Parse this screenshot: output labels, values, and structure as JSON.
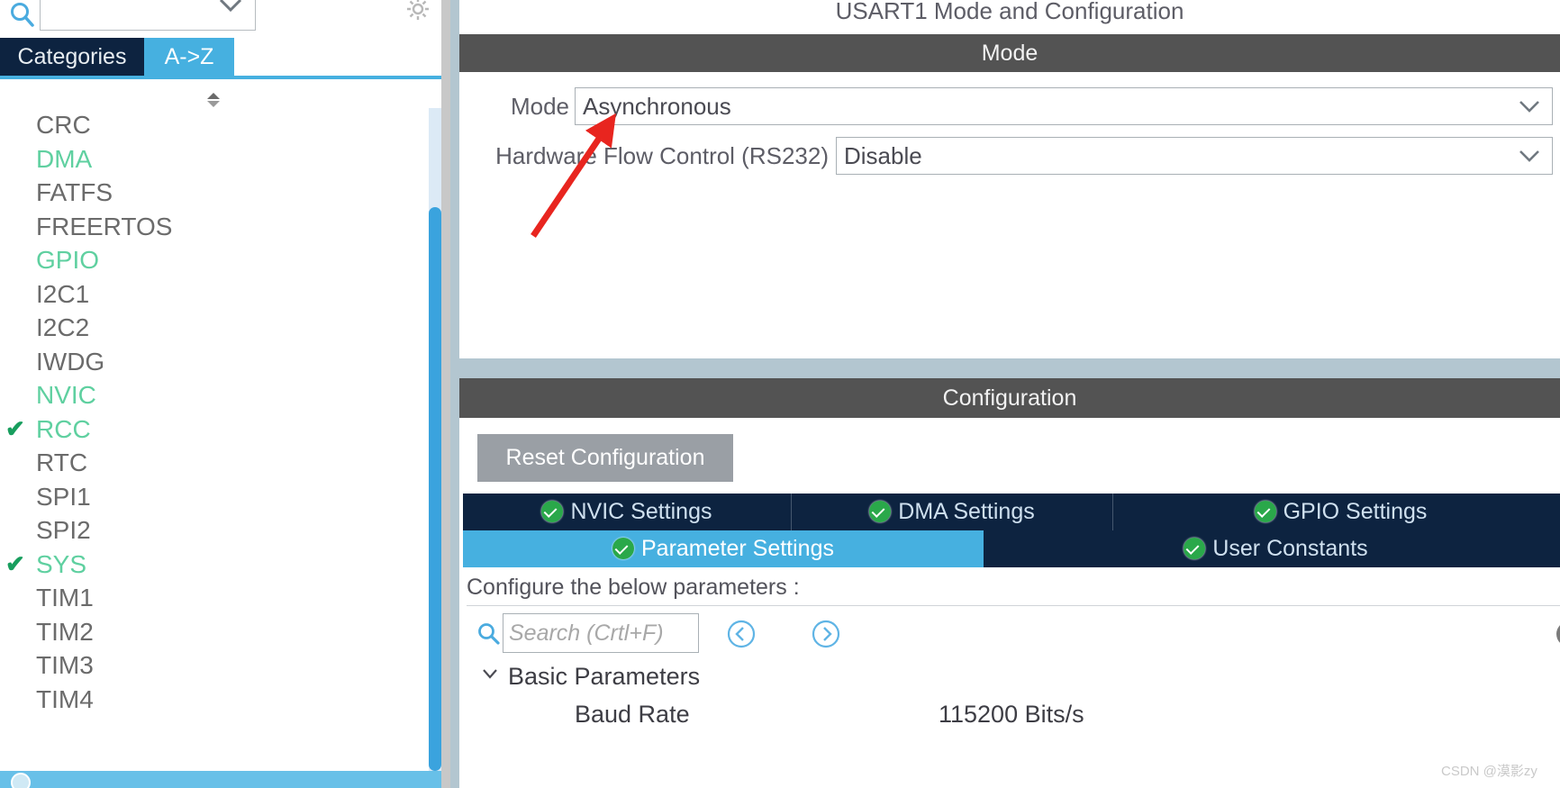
{
  "left_panel": {
    "search": {
      "value": "",
      "placeholder": ""
    },
    "gear_icon": "gear-icon",
    "search_icon": "search-icon",
    "tabs": [
      {
        "label": "Categories",
        "active": false
      },
      {
        "label": "A->Z",
        "active": true
      }
    ],
    "ip_items": [
      {
        "label": "CRC",
        "enabled": false,
        "checked": false
      },
      {
        "label": "DMA",
        "enabled": true,
        "checked": false
      },
      {
        "label": "FATFS",
        "enabled": false,
        "checked": false
      },
      {
        "label": "FREERTOS",
        "enabled": false,
        "checked": false
      },
      {
        "label": "GPIO",
        "enabled": true,
        "checked": false
      },
      {
        "label": "I2C1",
        "enabled": false,
        "checked": false
      },
      {
        "label": "I2C2",
        "enabled": false,
        "checked": false
      },
      {
        "label": "IWDG",
        "enabled": false,
        "checked": false
      },
      {
        "label": "NVIC",
        "enabled": true,
        "checked": false
      },
      {
        "label": "RCC",
        "enabled": true,
        "checked": true
      },
      {
        "label": "RTC",
        "enabled": false,
        "checked": false
      },
      {
        "label": "SPI1",
        "enabled": false,
        "checked": false
      },
      {
        "label": "SPI2",
        "enabled": false,
        "checked": false
      },
      {
        "label": "SYS",
        "enabled": true,
        "checked": true
      },
      {
        "label": "TIM1",
        "enabled": false,
        "checked": false
      },
      {
        "label": "TIM2",
        "enabled": false,
        "checked": false
      },
      {
        "label": "TIM3",
        "enabled": false,
        "checked": false
      },
      {
        "label": "TIM4",
        "enabled": false,
        "checked": false
      }
    ]
  },
  "right_panel": {
    "title": "USART1 Mode and Configuration",
    "mode_section": {
      "header": "Mode",
      "fields": [
        {
          "label": "Mode",
          "value": "Asynchronous"
        },
        {
          "label": "Hardware Flow Control (RS232)",
          "value": "Disable"
        }
      ]
    },
    "configuration_section": {
      "header": "Configuration",
      "reset_button": "Reset Configuration",
      "tabs_row_1": [
        {
          "label": "NVIC Settings",
          "active": false,
          "ok": true
        },
        {
          "label": "DMA Settings",
          "active": false,
          "ok": true
        },
        {
          "label": "GPIO Settings",
          "active": false,
          "ok": true
        }
      ],
      "tabs_row_2": [
        {
          "label": "Parameter Settings",
          "active": true,
          "ok": true
        },
        {
          "label": "User Constants",
          "active": false,
          "ok": true
        }
      ],
      "hint": "Configure the below parameters :",
      "search": {
        "value": "",
        "placeholder": "Search (Crtl+F)"
      },
      "nav_prev_icon": "circle-arrow-left-icon",
      "nav_next_icon": "circle-arrow-right-icon",
      "info_icon": "info-icon",
      "parameter_groups": [
        {
          "name": "Basic Parameters",
          "expanded": true,
          "parameters": [
            {
              "name": "Baud Rate",
              "value": "115200 Bits/s"
            }
          ]
        }
      ]
    }
  },
  "annotation": {
    "arrow_color": "#e8251f"
  },
  "watermark": "CSDN @漠影zy",
  "colors": {
    "accent_blue": "#46b0e0",
    "tab_navy": "#0d2340",
    "header_gray": "#535353",
    "panel_bg": "#b3c6d0",
    "ip_enabled_green": "#5fd0a0",
    "check_green": "#189e5e"
  }
}
